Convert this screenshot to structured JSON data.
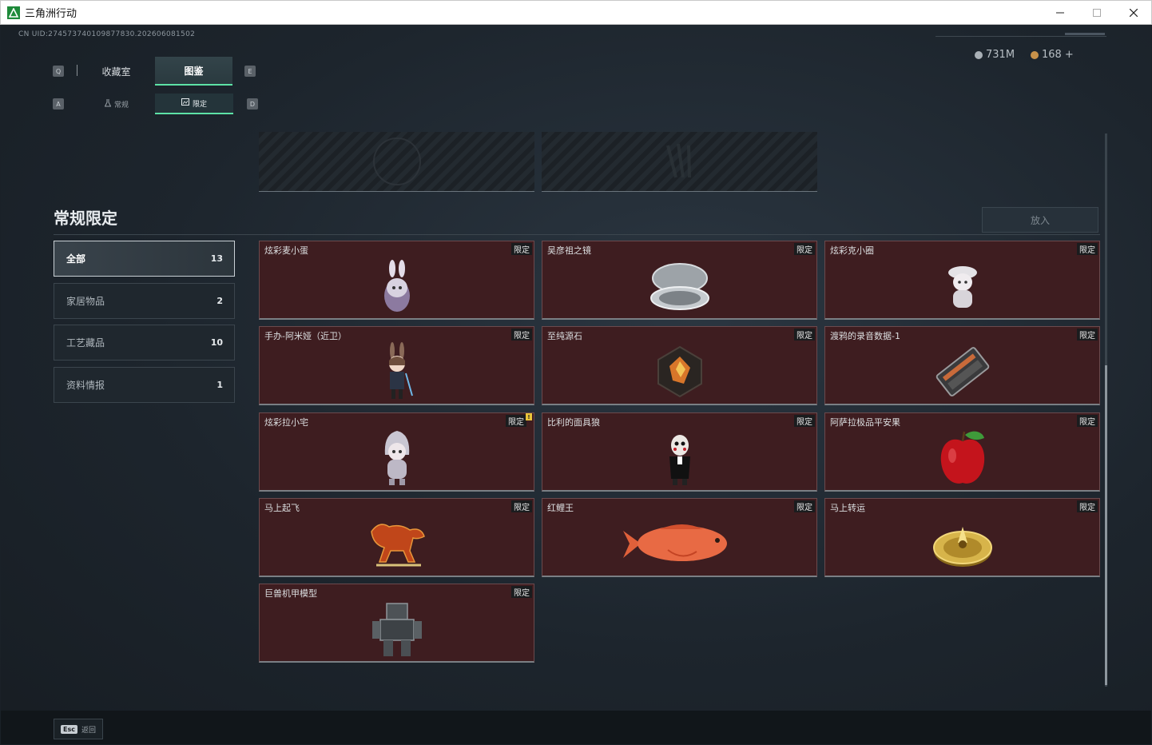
{
  "window": {
    "title": "三角洲行动"
  },
  "header": {
    "uid": "CN UID:274573740109877830.202606081502",
    "tabs": [
      {
        "label": "收藏室"
      },
      {
        "label": "图鉴"
      }
    ],
    "subtabs": [
      {
        "label": "常规"
      },
      {
        "label": "限定"
      }
    ],
    "keys": {
      "prev_tab": "Q",
      "next_tab": "E",
      "prev_sub": "A",
      "next_sub": "D"
    },
    "currency": {
      "money": "731M",
      "coins": "168",
      "add": "+"
    }
  },
  "section": {
    "title": "常规限定",
    "put_button": "放入"
  },
  "categories": [
    {
      "label": "全部",
      "count": "13"
    },
    {
      "label": "家居物品",
      "count": "2"
    },
    {
      "label": "工艺藏品",
      "count": "10"
    },
    {
      "label": "资料情报",
      "count": "1"
    }
  ],
  "items": [
    {
      "name": "炫彩麦小蛋",
      "tag": "限定",
      "icon": "bunny-egg-figure-icon"
    },
    {
      "name": "吴彦祖之镜",
      "tag": "限定",
      "icon": "compact-mirror-icon"
    },
    {
      "name": "炫彩克小圈",
      "tag": "限定",
      "icon": "hat-figure-icon"
    },
    {
      "name": "手办-阿米娅（近卫）",
      "tag": "限定",
      "icon": "amiya-figure-icon"
    },
    {
      "name": "至纯源石",
      "tag": "限定",
      "icon": "originium-crystal-icon"
    },
    {
      "name": "渡鸦的录音数据-1",
      "tag": "限定",
      "icon": "data-recorder-icon"
    },
    {
      "name": "炫彩拉小宅",
      "tag": "限定",
      "icon": "hooded-figure-icon",
      "new": "!"
    },
    {
      "name": "比利的面具狼",
      "tag": "限定",
      "icon": "billy-puppet-icon"
    },
    {
      "name": "阿萨拉极品平安果",
      "tag": "限定",
      "icon": "apple-icon"
    },
    {
      "name": "马上起飞",
      "tag": "限定",
      "icon": "flying-horse-icon"
    },
    {
      "name": "红鲤王",
      "tag": "限定",
      "icon": "red-carp-icon"
    },
    {
      "name": "马上转运",
      "tag": "限定",
      "icon": "golden-wheel-icon"
    },
    {
      "name": "巨兽机甲模型",
      "tag": "限定",
      "icon": "mech-model-icon"
    }
  ],
  "footer": {
    "esc_key": "Esc",
    "esc_label": "返回"
  },
  "colors": {
    "accent": "#5de2a6",
    "card_bg": "#3e1d20",
    "card_border": "#6b4a4d"
  }
}
